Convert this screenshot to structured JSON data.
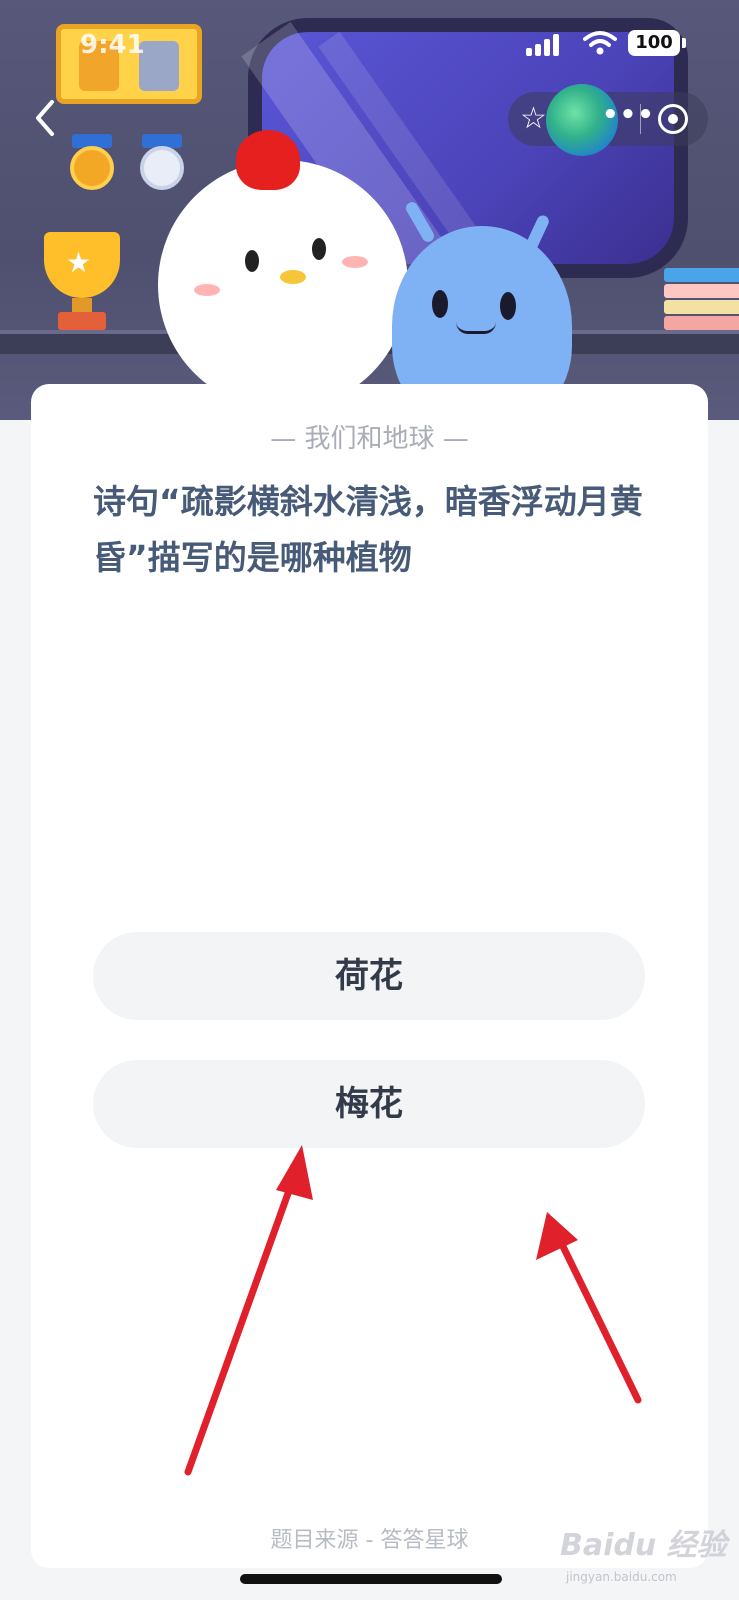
{
  "status_bar": {
    "time": "9:41",
    "battery": "100"
  },
  "category": "— 我们和地球 —",
  "question": "诗句“疏影横斜水清浅，暗香浮动月黄昏”描写的是哪种植物",
  "options": [
    "荷花",
    "梅花"
  ],
  "footer_source": "题目来源 - 答答星球",
  "watermark": {
    "brand": "Baidu 经验",
    "url": "jingyan.baidu.com"
  },
  "annotation_color": "#e0202a"
}
